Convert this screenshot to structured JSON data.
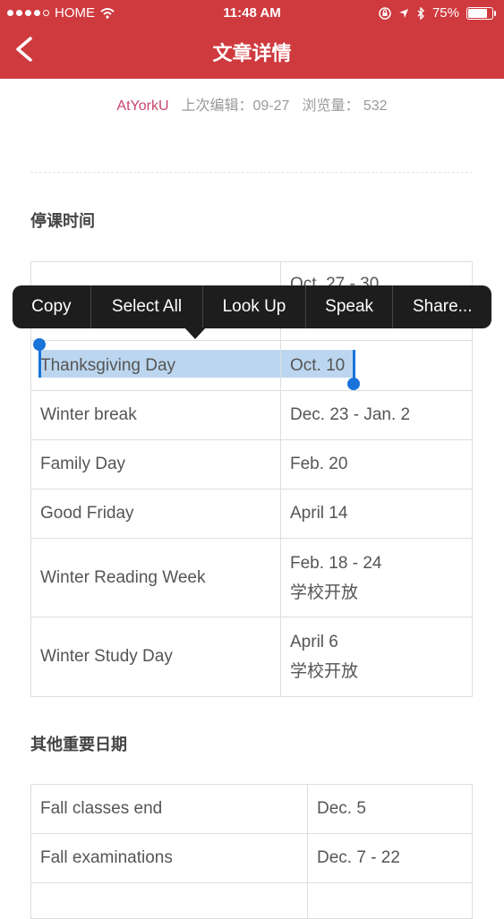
{
  "status_bar": {
    "carrier": "HOME",
    "time": "11:48 AM",
    "battery": "75%"
  },
  "nav": {
    "title": "文章详情"
  },
  "meta": {
    "author": "AtYorkU",
    "edited": "上次编辑：09-27",
    "views": "浏览量： 532"
  },
  "section1": {
    "title": "停课时间",
    "rows": [
      {
        "name": "",
        "date": "Oct. 27 - 30",
        "date2": ""
      },
      {
        "name": "Thanksgiving Day",
        "date": "Oct. 10",
        "date2": ""
      },
      {
        "name": "Winter break",
        "date": "Dec. 23 - Jan. 2",
        "date2": ""
      },
      {
        "name": "Family Day",
        "date": "Feb. 20",
        "date2": ""
      },
      {
        "name": "Good Friday",
        "date": "April 14",
        "date2": ""
      },
      {
        "name": "Winter Reading Week",
        "date": "Feb. 18 - 24",
        "date2": "学校开放"
      },
      {
        "name": "Winter Study Day",
        "date": "April 6",
        "date2": "学校开放"
      }
    ]
  },
  "section2": {
    "title": "其他重要日期",
    "rows": [
      {
        "name": "Fall classes end",
        "date": "Dec. 5"
      },
      {
        "name": "Fall examinations",
        "date": "Dec. 7 - 22"
      },
      {
        "name": "",
        "date": ""
      }
    ]
  },
  "context_menu": {
    "items": [
      "Copy",
      "Select All",
      "Look Up",
      "Speak",
      "Share..."
    ]
  }
}
